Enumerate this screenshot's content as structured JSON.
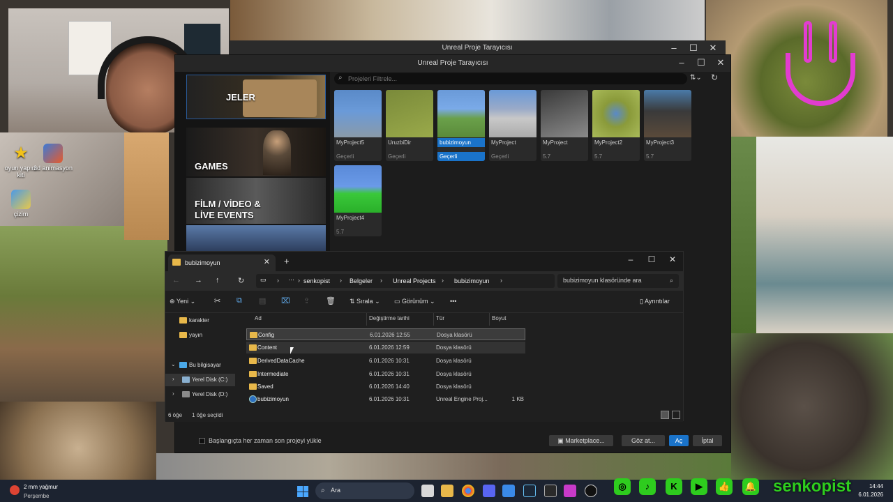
{
  "desktop": {
    "icons": [
      {
        "label": "oyun yapım\nkiti"
      },
      {
        "label": "3d animasyon"
      },
      {
        "label": "çizim"
      }
    ]
  },
  "ue_back": {
    "title": "Unreal Proje Tarayıcısı"
  },
  "ue": {
    "title": "Unreal Proje Tarayıcısı",
    "categories": [
      {
        "label": "JELER"
      },
      {
        "label": "GAMES"
      },
      {
        "label": "FİLM / VİDEO & LİVE EVENTS"
      }
    ],
    "filter_placeholder": "Projeleri Filtrele...",
    "projects": [
      {
        "name": "MyProject5",
        "status": "Geçerli"
      },
      {
        "name": "UruzbiDir",
        "status": "Geçerli"
      },
      {
        "name": "bubizimoyun",
        "status": "Geçerli"
      },
      {
        "name": "MyProject",
        "status": "Geçerli"
      },
      {
        "name": "MyProject",
        "status": "5.7"
      },
      {
        "name": "MyProject2",
        "status": "5.7"
      },
      {
        "name": "MyProject3",
        "status": "5.7"
      },
      {
        "name": "MyProject4",
        "status": "5.7"
      }
    ],
    "startup_checkbox_label": "Başlangıçta her zaman son projeyi yükle",
    "marketplace_label": "Marketplace...",
    "browse_label": "Göz at...",
    "open_label": "Aç",
    "cancel_label": "İptal"
  },
  "explorer": {
    "tab_title": "bubizimoyun",
    "breadcrumbs": [
      "senkopist",
      "Belgeler",
      "Unreal Projects",
      "bubizimoyun"
    ],
    "search_placeholder": "bubizimoyun klasöründe ara",
    "cmd": {
      "new": "Yeni",
      "sort": "Sırala",
      "view": "Görünüm",
      "more": "•••",
      "details": "Ayrıntılar"
    },
    "nav": [
      {
        "label": "karakter"
      },
      {
        "label": "yayın"
      },
      {
        "label": "Bu bilgisayar"
      },
      {
        "label": "Yerel Disk (C:)"
      },
      {
        "label": "Yerel Disk (D:)"
      }
    ],
    "columns": [
      "Ad",
      "Değiştirme tarihi",
      "Tür",
      "Boyut"
    ],
    "rows": [
      {
        "name": "Config",
        "date": "6.01.2026 12:55",
        "type": "Dosya klasörü",
        "size": ""
      },
      {
        "name": "Content",
        "date": "6.01.2026 12:59",
        "type": "Dosya klasörü",
        "size": ""
      },
      {
        "name": "DerivedDataCache",
        "date": "6.01.2026 10:31",
        "type": "Dosya klasörü",
        "size": ""
      },
      {
        "name": "Intermediate",
        "date": "6.01.2026 10:31",
        "type": "Dosya klasörü",
        "size": ""
      },
      {
        "name": "Saved",
        "date": "6.01.2026 14:40",
        "type": "Dosya klasörü",
        "size": ""
      },
      {
        "name": "bubizimoyun",
        "date": "6.01.2026 10:31",
        "type": "Unreal Engine Proj...",
        "size": "1 KB"
      }
    ],
    "status_count": "6 öğe",
    "status_selected": "1 öğe seçildi"
  },
  "taskbar": {
    "weather_line1": "2 mm yağmur",
    "weather_line2": "Perşembe",
    "search_label": "Ara",
    "time": "14:44",
    "date": "6.01.2026"
  },
  "social": {
    "handle": "senkopist",
    "colors": {
      "accent": "#2ecc1e"
    }
  },
  "colors": {
    "ue_selection": "#1a73c9",
    "folder": "#e8b84a"
  }
}
